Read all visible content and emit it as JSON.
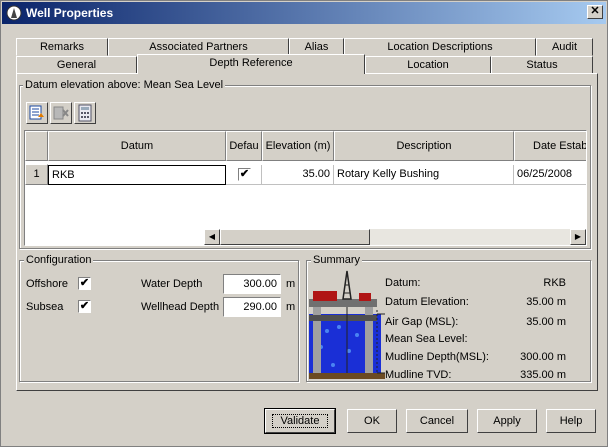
{
  "window": {
    "title": "Well Properties",
    "close_glyph": "✕"
  },
  "tabs": {
    "row_top": [
      "Remarks",
      "Associated Partners",
      "Alias",
      "Location Descriptions",
      "Audit"
    ],
    "row_bottom": [
      "General",
      "Depth Reference",
      "Location",
      "Status"
    ],
    "active": "Depth Reference"
  },
  "datum_group": {
    "label": "Datum elevation above: Mean Sea Level",
    "toolbar_icons": [
      "add-row-icon",
      "delete-row-icon",
      "calculator-icon"
    ],
    "grid": {
      "columns": [
        "Datum",
        "Defau",
        "Elevation (m)",
        "Description",
        "Date Establishe"
      ],
      "rows": [
        {
          "num": "1",
          "datum": "RKB",
          "default_checked": "✔",
          "elevation": "35.00",
          "description": "Rotary Kelly Bushing",
          "date": "06/25/2008"
        }
      ]
    },
    "scroll_left": "◀",
    "scroll_right": "▶"
  },
  "configuration": {
    "label": "Configuration",
    "offshore_label": "Offshore",
    "offshore_checked": "✔",
    "subsea_label": "Subsea",
    "subsea_checked": "✔",
    "water_depth_label": "Water Depth",
    "water_depth_value": "300.00",
    "water_depth_unit": "m",
    "wellhead_depth_label": "Wellhead Depth",
    "wellhead_depth_value": "290.00",
    "wellhead_depth_unit": "m"
  },
  "summary": {
    "label": "Summary",
    "rows": [
      {
        "label": "Datum:",
        "value": "RKB"
      },
      {
        "label": "Datum Elevation:",
        "value": "35.00 m"
      },
      {
        "label": "Air Gap (MSL):",
        "value": "35.00 m"
      },
      {
        "label": "Mean Sea Level:",
        "value": ""
      },
      {
        "label": "Mudline Depth(MSL):",
        "value": "300.00 m"
      },
      {
        "label": "Mudline TVD:",
        "value": "335.00 m"
      }
    ]
  },
  "buttons": {
    "validate": "Validate",
    "ok": "OK",
    "cancel": "Cancel",
    "apply": "Apply",
    "help": "Help"
  },
  "colors": {
    "title_start": "#0a246a",
    "title_end": "#a6caf0",
    "water": "#1a2fd6",
    "rig_red": "#b01515"
  }
}
